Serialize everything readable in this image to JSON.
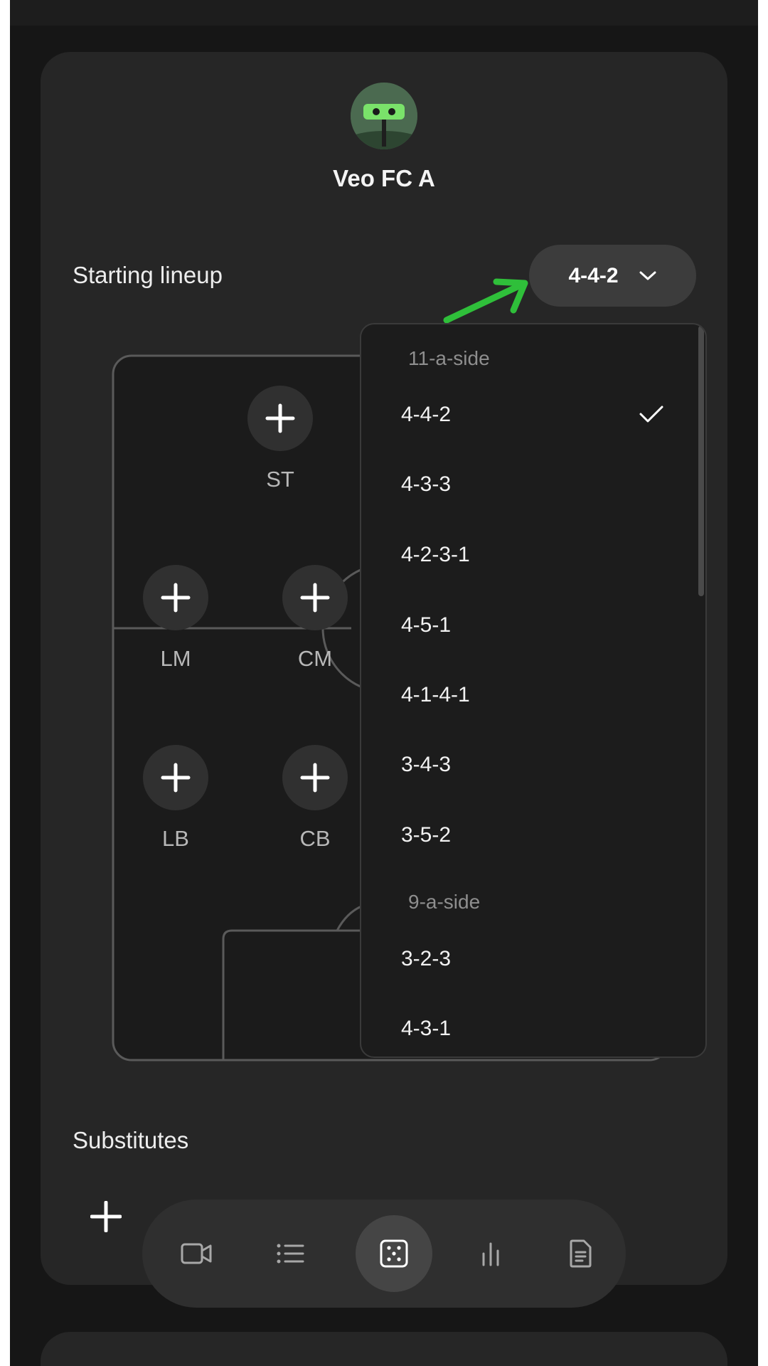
{
  "team": {
    "name": "Veo FC A"
  },
  "lineup": {
    "title": "Starting lineup",
    "formation_selected": "4-4-2"
  },
  "positions": [
    {
      "label": "ST"
    },
    {
      "label": "LM"
    },
    {
      "label": "CM"
    },
    {
      "label": "LB"
    },
    {
      "label": "CB"
    }
  ],
  "dropdown": {
    "groups": [
      {
        "label": "11-a-side",
        "options": [
          "4-4-2",
          "4-3-3",
          "4-2-3-1",
          "4-5-1",
          "4-1-4-1",
          "3-4-3",
          "3-5-2"
        ]
      },
      {
        "label": "9-a-side",
        "options": [
          "3-2-3",
          "4-3-1"
        ]
      }
    ],
    "selected": "4-4-2"
  },
  "substitutes": {
    "title": "Substitutes"
  },
  "bottom_nav": {
    "items": [
      {
        "icon": "video-camera-icon",
        "active": false
      },
      {
        "icon": "list-icon",
        "active": false
      },
      {
        "icon": "formation-icon",
        "active": true
      },
      {
        "icon": "bar-chart-icon",
        "active": false
      },
      {
        "icon": "document-icon",
        "active": false
      }
    ]
  },
  "colors": {
    "background": "#161616",
    "card": "#262626",
    "accent_arrow": "#2fbf3a"
  }
}
